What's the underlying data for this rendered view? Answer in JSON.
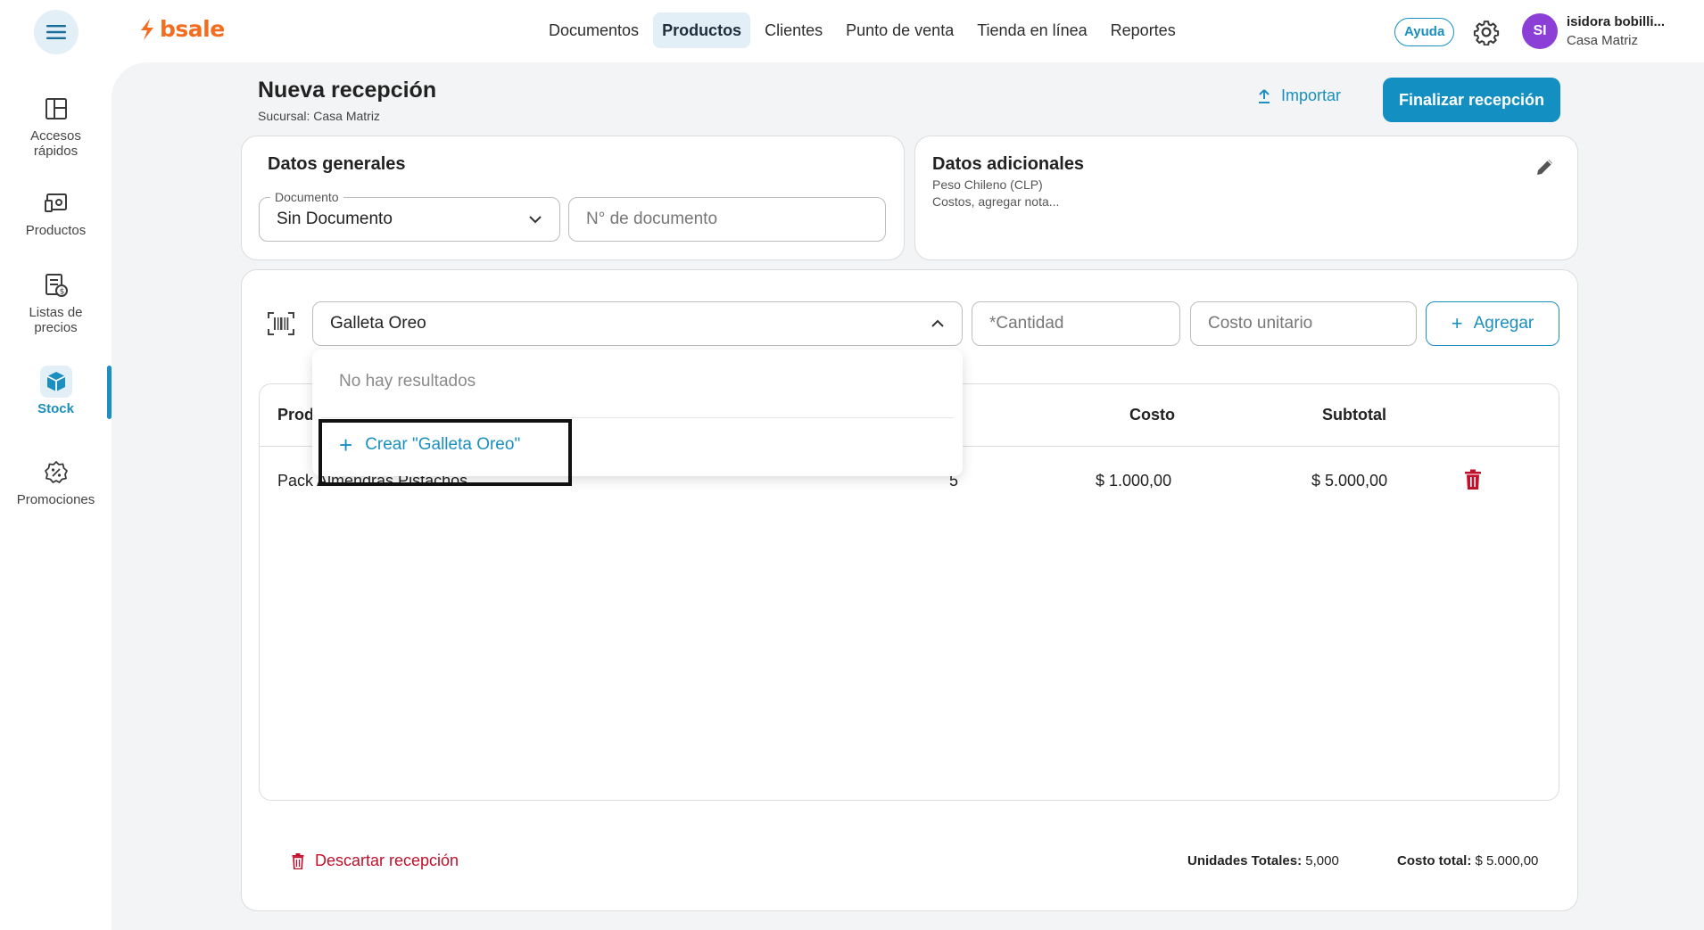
{
  "brand": {
    "name": "bsale"
  },
  "nav": {
    "items": [
      "Documentos",
      "Productos",
      "Clientes",
      "Punto de venta",
      "Tienda en línea",
      "Reportes"
    ],
    "active": "Productos"
  },
  "header": {
    "help_label": "Ayuda",
    "avatar_initials": "SI",
    "user_name": "isidora bobilli...",
    "user_branch": "Casa Matriz"
  },
  "sidebar": {
    "items": [
      {
        "label": "Accesos rápidos",
        "icon": "layout-icon"
      },
      {
        "label": "Productos",
        "icon": "products-icon"
      },
      {
        "label": "Listas de precios",
        "icon": "price-list-icon"
      },
      {
        "label": "Stock",
        "icon": "box-icon",
        "active": true
      },
      {
        "label": "Promociones",
        "icon": "promo-badge-icon"
      }
    ]
  },
  "page": {
    "title": "Nueva recepción",
    "subtitle": "Sucursal: Casa Matriz",
    "import_label": "Importar",
    "finish_label": "Finalizar recepción"
  },
  "general": {
    "title": "Datos generales",
    "document_label": "Documento",
    "document_value": "Sin Documento",
    "doc_number_placeholder": "N° de documento"
  },
  "additional": {
    "title": "Datos adicionales",
    "currency": "Peso Chileno (CLP)",
    "notes": "Costos, agregar nota..."
  },
  "entry": {
    "product_search_value": "Galleta Oreo",
    "quantity_placeholder": "*Cantidad",
    "unit_cost_placeholder": "Costo unitario",
    "add_label": "Agregar"
  },
  "dropdown": {
    "empty_text": "No hay resultados",
    "create_label": "Crear \"Galleta Oreo\""
  },
  "table": {
    "headers": {
      "product": "Prod",
      "cost": "Costo",
      "subtotal": "Subtotal"
    },
    "rows": [
      {
        "product": "Pack Almendras Pistachos",
        "quantity": "5",
        "cost": "$ 1.000,00",
        "subtotal": "$ 5.000,00"
      }
    ]
  },
  "footer": {
    "discard_label": "Descartar recepción",
    "units_label": "Unidades Totales:",
    "units_value": "5,000",
    "cost_label": "Costo total:",
    "cost_value": "$ 5.000,00"
  },
  "colors": {
    "primary": "#148fc1",
    "brand_orange": "#f36d21",
    "danger": "#c0102b",
    "avatar": "#8b3fd6"
  }
}
